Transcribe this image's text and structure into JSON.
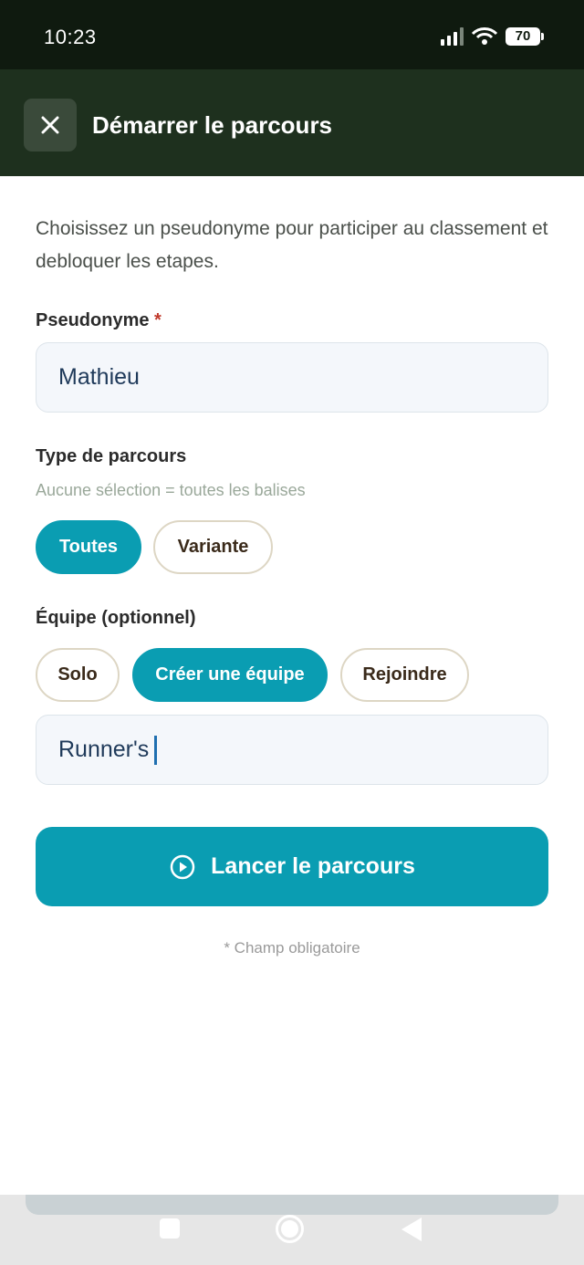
{
  "status_bar": {
    "time": "10:23",
    "battery": "70"
  },
  "header": {
    "title": "Démarrer le parcours",
    "close_icon": "close-icon"
  },
  "form": {
    "intro": "Choisissez un pseudonyme pour participer au classement et debloquer les etapes.",
    "pseudo_label": "Pseudonyme",
    "pseudo_required": "*",
    "pseudo_value": "Mathieu",
    "type_label": "Type de parcours",
    "type_hint": "Aucune sélection = toutes les balises",
    "type_options": [
      "Toutes",
      "Variante"
    ],
    "type_selected": "Toutes",
    "team_label": "Équipe (optionnel)",
    "team_options": [
      "Solo",
      "Créer une équipe",
      "Rejoindre"
    ],
    "team_selected": "Créer une équipe",
    "team_name_value": "Runner's",
    "launch_label": "Lancer le parcours",
    "launch_icon": "play-circle-icon",
    "footnote": "* Champ obligatoire"
  },
  "colors": {
    "accent": "#0a9db2",
    "header_bg": "#1e301e",
    "status_bg": "#0f1a0f",
    "required": "#c0392b"
  }
}
